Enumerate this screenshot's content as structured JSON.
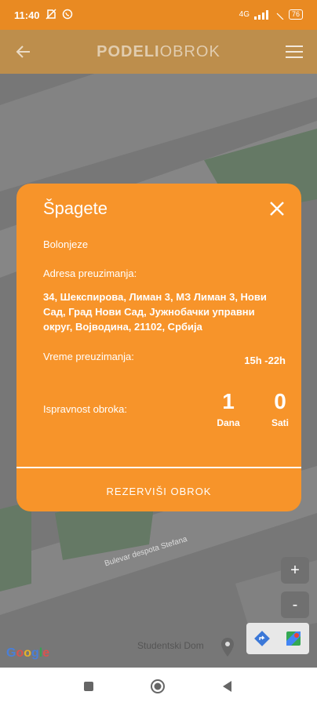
{
  "status": {
    "time": "11:40",
    "left_icons": [
      "no-sim-icon",
      "viber-icon"
    ],
    "signal": "4G",
    "battery": "76"
  },
  "app_bar": {
    "title_bold": "PODELI",
    "title_light": "OBROK"
  },
  "meal": {
    "title": "Špagete",
    "description": "Bolonjeze",
    "address_label": "Adresa preuzimanja:",
    "address": "34, Шекспирова, Лиман 3, МЗ Лиман 3, Нови Сад, Град Нови Сад, Јужнобачки управни округ, Војводина, 21102, Србија",
    "time_label": "Vreme preuzimanja:",
    "time_value": "15h -22h",
    "validity_label": "Ispravnost obroka:",
    "validity_days": "1",
    "days_unit": "Dana",
    "validity_hours": "0",
    "hours_unit": "Sati",
    "reserve_label": "REZERVIŠI OBROK"
  },
  "map": {
    "street_label": "Bulevar despota Stefana",
    "place_label": "Studentski Dom",
    "google_logo": "Google",
    "zoom_in": "+",
    "zoom_out": "-"
  },
  "colors": {
    "accent": "#f7942a",
    "status_bar": "#e98a22"
  }
}
